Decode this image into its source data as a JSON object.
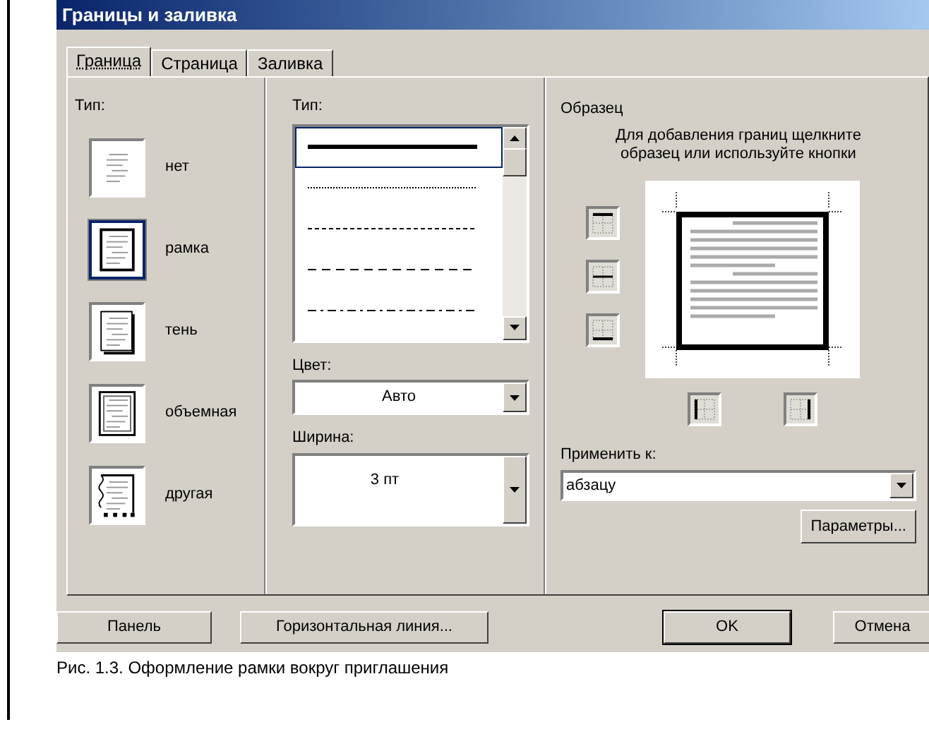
{
  "window": {
    "title": "Границы и заливка"
  },
  "tabs": [
    {
      "label": "Граница",
      "selected": true
    },
    {
      "label": "Страница",
      "selected": false
    },
    {
      "label": "Заливка",
      "selected": false
    }
  ],
  "setting": {
    "label": "Тип:",
    "items": [
      {
        "label": "нет",
        "kind": "none",
        "selected": false
      },
      {
        "label": "рамка",
        "kind": "box",
        "selected": true
      },
      {
        "label": "тень",
        "kind": "shadow",
        "selected": false
      },
      {
        "label": "объемная",
        "kind": "raised",
        "selected": false
      },
      {
        "label": "другая",
        "kind": "custom",
        "selected": false
      }
    ]
  },
  "style": {
    "label": "Тип:",
    "items": [
      {
        "kind": "solid",
        "selected": true
      },
      {
        "kind": "dotted",
        "selected": false
      },
      {
        "kind": "dashed",
        "selected": false
      },
      {
        "kind": "dashed-wide",
        "selected": false
      },
      {
        "kind": "dash-dot",
        "selected": false
      }
    ]
  },
  "color": {
    "label": "Цвет:",
    "value": "Авто"
  },
  "width": {
    "label": "Ширина:",
    "value": "3 пт"
  },
  "preview": {
    "label": "Образец",
    "hint": "Для добавления границ щелкните образец или используйте кнопки"
  },
  "apply_to": {
    "label": "Применить к:",
    "value": "абзацу"
  },
  "options_button": "Параметры...",
  "buttons": [
    "Панель",
    "Горизонтальная линия...",
    "OK",
    "Отмена"
  ],
  "caption": "Рис. 1.3. Оформление рамки вокруг приглашения"
}
